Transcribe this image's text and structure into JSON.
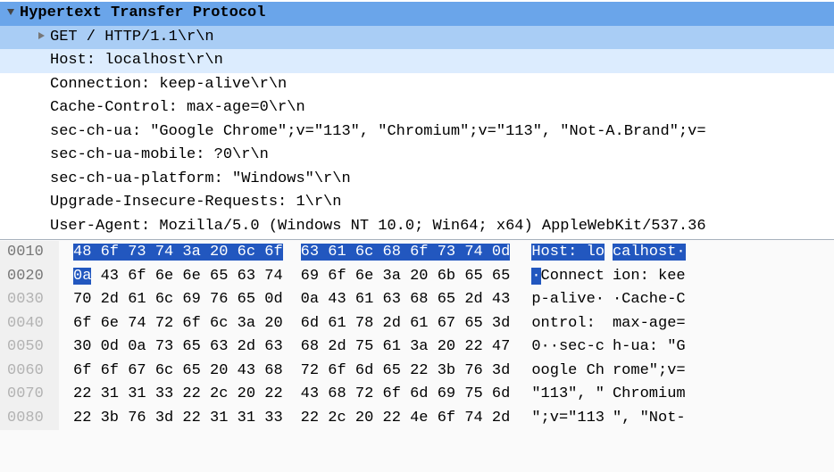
{
  "tree": {
    "title": "Hypertext Transfer Protocol",
    "items": [
      {
        "expander": true,
        "sel": "get",
        "text": "GET / HTTP/1.1\\r\\n"
      },
      {
        "expander": false,
        "sel": "host",
        "text": "Host: localhost\\r\\n"
      },
      {
        "expander": false,
        "sel": "",
        "text": "Connection: keep-alive\\r\\n"
      },
      {
        "expander": false,
        "sel": "",
        "text": "Cache-Control: max-age=0\\r\\n"
      },
      {
        "expander": false,
        "sel": "",
        "text": "sec-ch-ua: \"Google Chrome\";v=\"113\", \"Chromium\";v=\"113\", \"Not-A.Brand\";v="
      },
      {
        "expander": false,
        "sel": "",
        "text": "sec-ch-ua-mobile: ?0\\r\\n"
      },
      {
        "expander": false,
        "sel": "",
        "text": "sec-ch-ua-platform: \"Windows\"\\r\\n"
      },
      {
        "expander": false,
        "sel": "",
        "text": "Upgrade-Insecure-Requests: 1\\r\\n"
      },
      {
        "expander": false,
        "sel": "",
        "text": "User-Agent: Mozilla/5.0 (Windows NT 10.0; Win64; x64) AppleWebKit/537.36"
      }
    ]
  },
  "hex": {
    "highlight_offsets": [
      "0010",
      "0020"
    ],
    "rows": [
      {
        "offset": "0010",
        "b1": [
          "48",
          "6f",
          "73",
          "74",
          "3a",
          "20",
          "6c",
          "6f"
        ],
        "b2": [
          "63",
          "61",
          "6c",
          "68",
          "6f",
          "73",
          "74",
          "0d"
        ],
        "hl1": [
          1,
          1,
          1,
          1,
          1,
          1,
          1,
          1
        ],
        "hl2": [
          1,
          1,
          1,
          1,
          1,
          1,
          1,
          1
        ],
        "a1": "Host: lo",
        "a2": "calhost·",
        "ahl1": [
          1,
          1,
          1,
          1,
          1,
          1,
          1,
          1
        ],
        "ahl2": [
          1,
          1,
          1,
          1,
          1,
          1,
          1,
          1
        ]
      },
      {
        "offset": "0020",
        "b1": [
          "0a",
          "43",
          "6f",
          "6e",
          "6e",
          "65",
          "63",
          "74"
        ],
        "b2": [
          "69",
          "6f",
          "6e",
          "3a",
          "20",
          "6b",
          "65",
          "65"
        ],
        "hl1": [
          1,
          0,
          0,
          0,
          0,
          0,
          0,
          0
        ],
        "hl2": [
          0,
          0,
          0,
          0,
          0,
          0,
          0,
          0
        ],
        "a1": "·Connect",
        "a2": "ion: kee",
        "ahl1": [
          1,
          0,
          0,
          0,
          0,
          0,
          0,
          0
        ],
        "ahl2": [
          0,
          0,
          0,
          0,
          0,
          0,
          0,
          0
        ]
      },
      {
        "offset": "0030",
        "b1": [
          "70",
          "2d",
          "61",
          "6c",
          "69",
          "76",
          "65",
          "0d"
        ],
        "b2": [
          "0a",
          "43",
          "61",
          "63",
          "68",
          "65",
          "2d",
          "43"
        ],
        "hl1": [
          0,
          0,
          0,
          0,
          0,
          0,
          0,
          0
        ],
        "hl2": [
          0,
          0,
          0,
          0,
          0,
          0,
          0,
          0
        ],
        "a1": "p-alive·",
        "a2": "·Cache-C",
        "ahl1": [
          0,
          0,
          0,
          0,
          0,
          0,
          0,
          0
        ],
        "ahl2": [
          0,
          0,
          0,
          0,
          0,
          0,
          0,
          0
        ]
      },
      {
        "offset": "0040",
        "b1": [
          "6f",
          "6e",
          "74",
          "72",
          "6f",
          "6c",
          "3a",
          "20"
        ],
        "b2": [
          "6d",
          "61",
          "78",
          "2d",
          "61",
          "67",
          "65",
          "3d"
        ],
        "hl1": [
          0,
          0,
          0,
          0,
          0,
          0,
          0,
          0
        ],
        "hl2": [
          0,
          0,
          0,
          0,
          0,
          0,
          0,
          0
        ],
        "a1": "ontrol: ",
        "a2": "max-age=",
        "ahl1": [
          0,
          0,
          0,
          0,
          0,
          0,
          0,
          0
        ],
        "ahl2": [
          0,
          0,
          0,
          0,
          0,
          0,
          0,
          0
        ]
      },
      {
        "offset": "0050",
        "b1": [
          "30",
          "0d",
          "0a",
          "73",
          "65",
          "63",
          "2d",
          "63"
        ],
        "b2": [
          "68",
          "2d",
          "75",
          "61",
          "3a",
          "20",
          "22",
          "47"
        ],
        "hl1": [
          0,
          0,
          0,
          0,
          0,
          0,
          0,
          0
        ],
        "hl2": [
          0,
          0,
          0,
          0,
          0,
          0,
          0,
          0
        ],
        "a1": "0··sec-c",
        "a2": "h-ua: \"G",
        "ahl1": [
          0,
          0,
          0,
          0,
          0,
          0,
          0,
          0
        ],
        "ahl2": [
          0,
          0,
          0,
          0,
          0,
          0,
          0,
          0
        ]
      },
      {
        "offset": "0060",
        "b1": [
          "6f",
          "6f",
          "67",
          "6c",
          "65",
          "20",
          "43",
          "68"
        ],
        "b2": [
          "72",
          "6f",
          "6d",
          "65",
          "22",
          "3b",
          "76",
          "3d"
        ],
        "hl1": [
          0,
          0,
          0,
          0,
          0,
          0,
          0,
          0
        ],
        "hl2": [
          0,
          0,
          0,
          0,
          0,
          0,
          0,
          0
        ],
        "a1": "oogle Ch",
        "a2": "rome\";v=",
        "ahl1": [
          0,
          0,
          0,
          0,
          0,
          0,
          0,
          0
        ],
        "ahl2": [
          0,
          0,
          0,
          0,
          0,
          0,
          0,
          0
        ]
      },
      {
        "offset": "0070",
        "b1": [
          "22",
          "31",
          "31",
          "33",
          "22",
          "2c",
          "20",
          "22"
        ],
        "b2": [
          "43",
          "68",
          "72",
          "6f",
          "6d",
          "69",
          "75",
          "6d"
        ],
        "hl1": [
          0,
          0,
          0,
          0,
          0,
          0,
          0,
          0
        ],
        "hl2": [
          0,
          0,
          0,
          0,
          0,
          0,
          0,
          0
        ],
        "a1": "\"113\", \"",
        "a2": "Chromium",
        "ahl1": [
          0,
          0,
          0,
          0,
          0,
          0,
          0,
          0
        ],
        "ahl2": [
          0,
          0,
          0,
          0,
          0,
          0,
          0,
          0
        ]
      },
      {
        "offset": "0080",
        "b1": [
          "22",
          "3b",
          "76",
          "3d",
          "22",
          "31",
          "31",
          "33"
        ],
        "b2": [
          "22",
          "2c",
          "20",
          "22",
          "4e",
          "6f",
          "74",
          "2d"
        ],
        "hl1": [
          0,
          0,
          0,
          0,
          0,
          0,
          0,
          0
        ],
        "hl2": [
          0,
          0,
          0,
          0,
          0,
          0,
          0,
          0
        ],
        "a1": "\";v=\"113",
        "a2": "\", \"Not-",
        "ahl1": [
          0,
          0,
          0,
          0,
          0,
          0,
          0,
          0
        ],
        "ahl2": [
          0,
          0,
          0,
          0,
          0,
          0,
          0,
          0
        ]
      }
    ]
  }
}
